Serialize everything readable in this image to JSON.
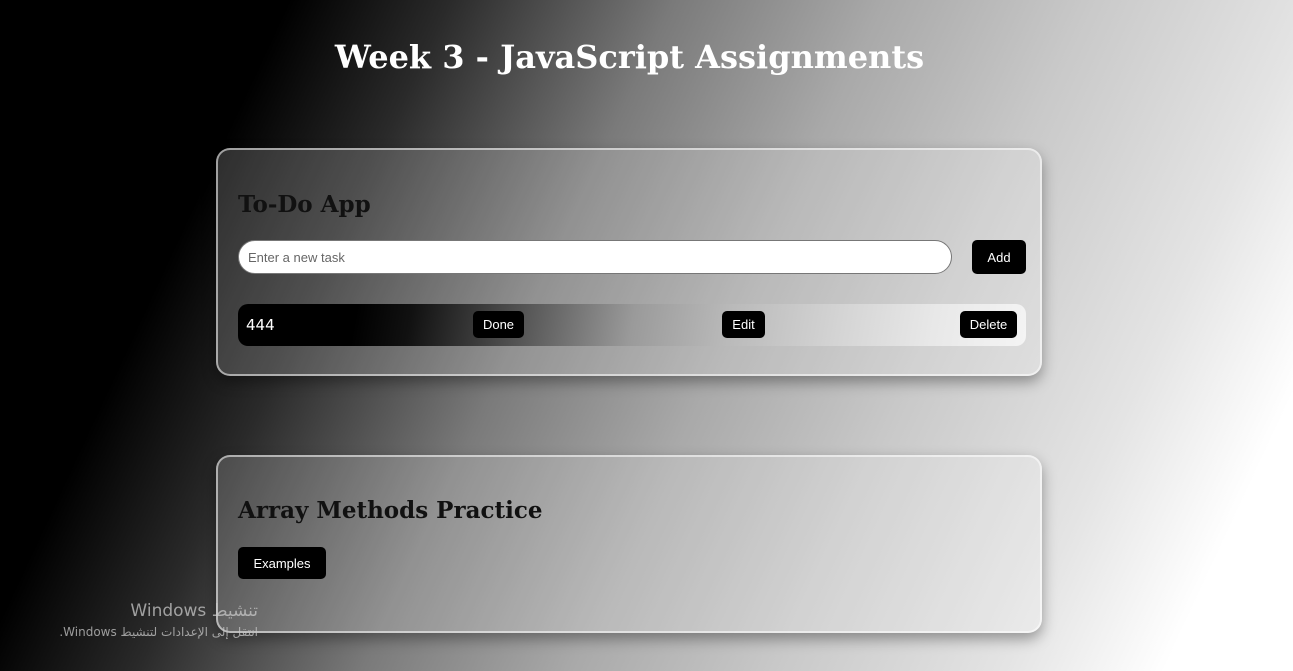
{
  "page": {
    "title": "Week 3 - JavaScript Assignments"
  },
  "todo": {
    "title": "To-Do App",
    "input": {
      "placeholder": "Enter a new task",
      "value": ""
    },
    "add_label": "Add",
    "tasks": [
      {
        "text": "444",
        "done_label": "Done",
        "edit_label": "Edit",
        "delete_label": "Delete"
      }
    ]
  },
  "arrays": {
    "title": "Array Methods Practice",
    "examples_label": "Examples"
  },
  "watermark": {
    "title": "تنشيط Windows",
    "subtitle": "انتقل إلى الإعدادات لتنشيط Windows."
  }
}
